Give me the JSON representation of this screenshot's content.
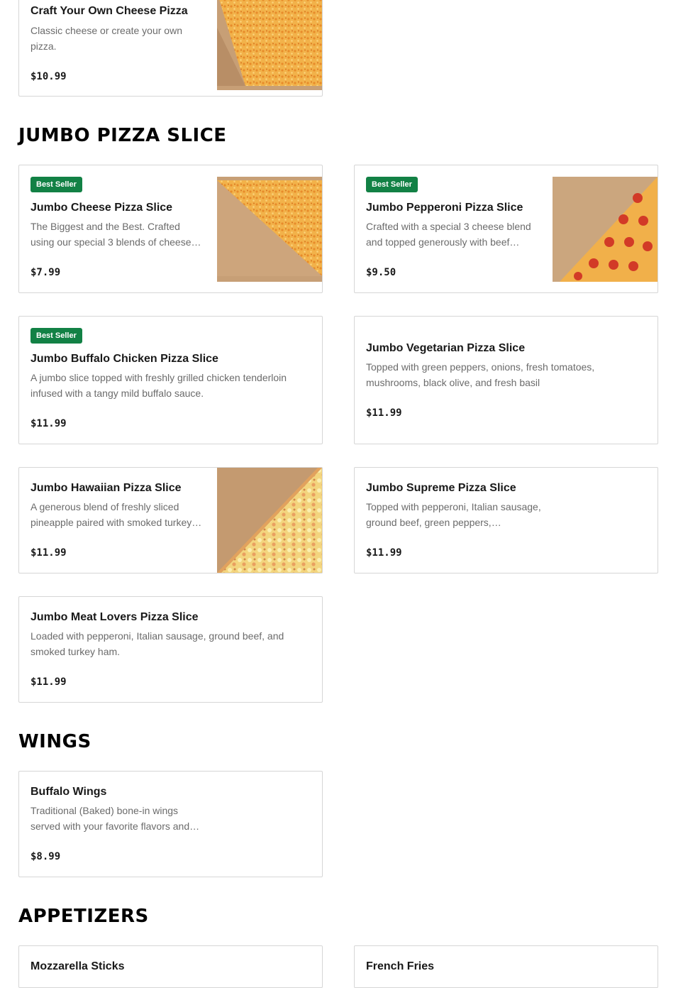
{
  "sections": {
    "jumbo": "JUMBO PIZZA SLICE",
    "wings": "WINGS",
    "appetizers": "APPETIZERS"
  },
  "badge_label": "Best Seller",
  "colors": {
    "badge": "#128145",
    "border": "#d6d6d6",
    "muted_text": "#6b6b6b"
  },
  "items": {
    "craft_cheese": {
      "title": "Craft Your Own Cheese Pizza",
      "desc": "Classic cheese or create your own pizza.",
      "price": "$10.99",
      "image": "cheese-pizza-slice"
    },
    "jumbo_cheese": {
      "title": "Jumbo Cheese Pizza Slice",
      "desc": "The Biggest and the Best. Crafted using our special 3 blends of cheese…",
      "price": "$7.99",
      "image": "cheese-pizza-slice"
    },
    "jumbo_pepperoni": {
      "title": "Jumbo Pepperoni Pizza Slice",
      "desc": "Crafted with a special 3 cheese blend and topped generously with beef…",
      "price": "$9.50",
      "image": "pepperoni-pizza-slice"
    },
    "jumbo_buffalo": {
      "title": "Jumbo Buffalo Chicken Pizza Slice",
      "desc": "A jumbo slice topped with freshly grilled chicken tenderloin infused with a tangy mild buffalo sauce.",
      "price": "$11.99"
    },
    "jumbo_vegetarian": {
      "title": "Jumbo Vegetarian Pizza Slice",
      "desc": "Topped with green peppers, onions, fresh tomatoes, mushrooms, black olive, and fresh basil",
      "price": "$11.99"
    },
    "jumbo_hawaiian": {
      "title": "Jumbo Hawaiian Pizza Slice",
      "desc": "A generous blend of freshly sliced pineapple paired with smoked turkey…",
      "price": "$11.99",
      "image": "hawaiian-pizza-slice"
    },
    "jumbo_supreme": {
      "title": "Jumbo Supreme Pizza Slice",
      "desc": "Topped with pepperoni, Italian sausage, ground beef, green peppers,…",
      "price": "$11.99"
    },
    "jumbo_meat": {
      "title": "Jumbo Meat Lovers Pizza Slice",
      "desc": "Loaded with pepperoni, Italian sausage, ground beef, and smoked turkey ham.",
      "price": "$11.99"
    },
    "buffalo_wings": {
      "title": "Buffalo Wings",
      "desc": "Traditional (Baked) bone-in wings served with your favorite flavors and…",
      "price": "$8.99"
    },
    "mozzarella": {
      "title": "Mozzarella Sticks"
    },
    "french_fries": {
      "title": "French Fries"
    }
  }
}
